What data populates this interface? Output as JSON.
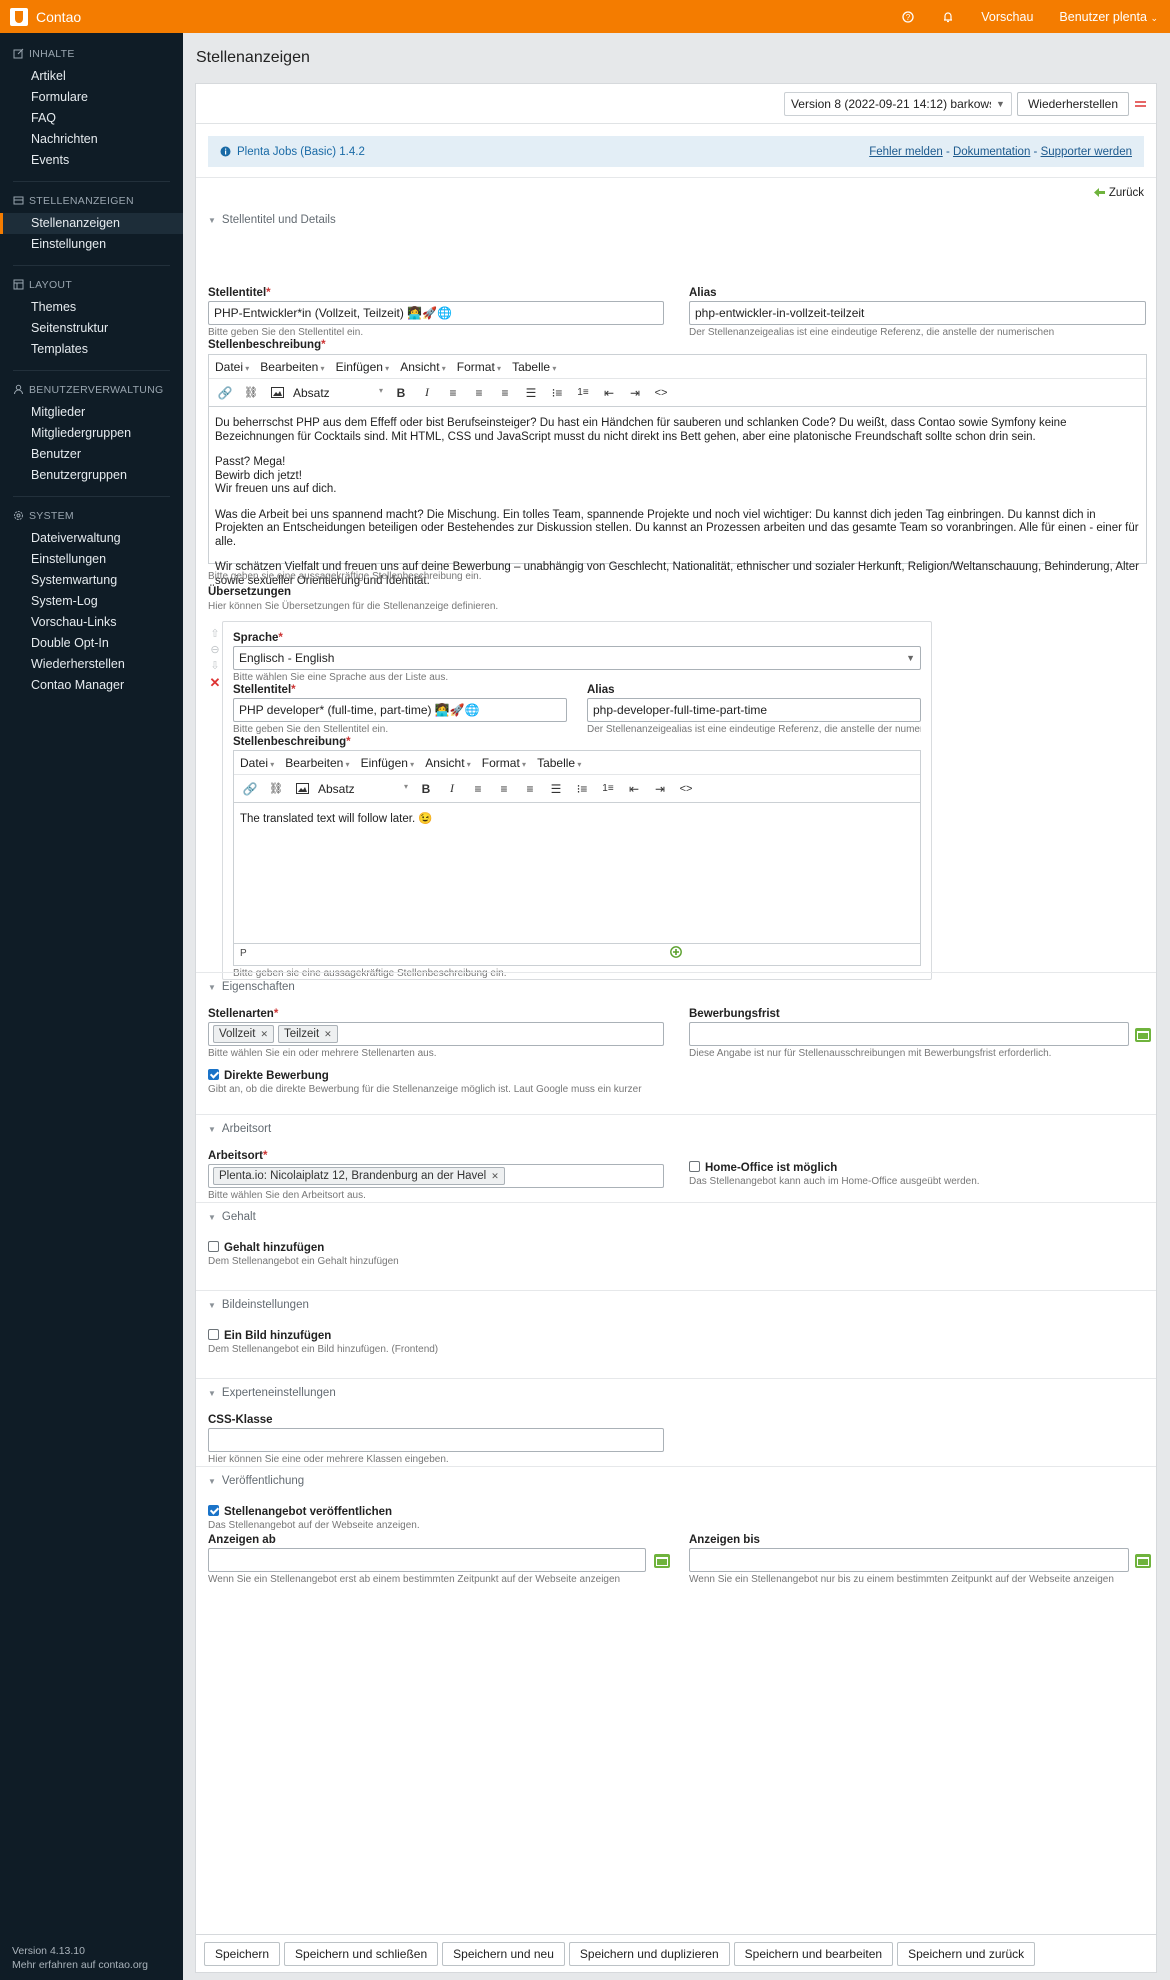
{
  "topbar": {
    "app": "Contao",
    "preview": "Vorschau",
    "user": "Benutzer plenta"
  },
  "sidebar": {
    "groups": [
      {
        "title": "INHALTE",
        "items": [
          "Artikel",
          "Formulare",
          "FAQ",
          "Nachrichten",
          "Events"
        ]
      },
      {
        "title": "STELLENANZEIGEN",
        "items": [
          "Stellenanzeigen",
          "Einstellungen"
        ]
      },
      {
        "title": "LAYOUT",
        "items": [
          "Themes",
          "Seitenstruktur",
          "Templates"
        ]
      },
      {
        "title": "BENUTZERVERWALTUNG",
        "items": [
          "Mitglieder",
          "Mitgliedergruppen",
          "Benutzer",
          "Benutzergruppen"
        ]
      },
      {
        "title": "SYSTEM",
        "items": [
          "Dateiverwaltung",
          "Einstellungen",
          "Systemwartung",
          "System-Log",
          "Vorschau-Links",
          "Double Opt-In",
          "Wiederherstellen",
          "Contao Manager"
        ]
      }
    ],
    "version": "Version 4.13.10",
    "more": "Mehr erfahren auf contao.org"
  },
  "page": {
    "title": "Stellenanzeigen"
  },
  "version_bar": {
    "version": "Version 8 (2022-09-21 14:12) barkowski",
    "restore": "Wiederherstellen"
  },
  "info": {
    "plugin": "Plenta Jobs (Basic) 1.4.2",
    "bug": "Fehler melden",
    "sep1": " - ",
    "docs": "Dokumentation",
    "sep2": " - ",
    "support": "Supporter werden"
  },
  "back": "Zurück",
  "sections": {
    "details": "Stellentitel und Details",
    "props": "Eigenschaften",
    "location": "Arbeitsort",
    "salary": "Gehalt",
    "image": "Bildeinstellungen",
    "expert": "Experteneinstellungen",
    "publish": "Veröffentlichung"
  },
  "details": {
    "title_label": "Stellentitel",
    "title_value": "PHP-Entwickler*in (Vollzeit, Teilzeit) 👩‍💻🚀🌐",
    "title_tip": "Bitte geben Sie den Stellentitel ein.",
    "alias_label": "Alias",
    "alias_value": "php-entwickler-in-vollzeit-teilzeit",
    "alias_tip": "Der Stellenanzeigealias ist eine eindeutige Referenz, die anstelle der numerischen",
    "desc_label": "Stellenbeschreibung",
    "desc_tip": "Bitte geben sie eine aussagekräftige Stellenbeschreibung ein.",
    "desc_p1": "Du beherrschst PHP aus dem Effeff oder bist Berufseinsteiger? Du hast ein Händchen für sauberen und schlanken Code? Du weißt, dass Contao sowie Symfony keine Bezeichnungen für Cocktails sind. Mit HTML, CSS und JavaScript musst du nicht direkt ins Bett gehen, aber eine platonische Freundschaft sollte schon drin sein.",
    "desc_p2a": "Passt? Mega!",
    "desc_p2b": "Bewirb dich jetzt!",
    "desc_p2c": "Wir freuen uns auf dich.",
    "desc_p3": "Was die Arbeit bei uns spannend macht? Die Mischung. Ein tolles Team, spannende Projekte und noch viel wichtiger: Du kannst dich jeden Tag einbringen. Du kannst dich in Projekten an Entscheidungen beteiligen oder Bestehendes zur Diskussion stellen. Du kannst an Prozessen arbeiten und das gesamte Team so voranbringen. Alle für einen - einer für alle.",
    "desc_p4": "Wir schätzen Vielfalt und freuen uns auf deine Bewerbung – unabhängig von Geschlecht, Nationalität, ethnischer und sozialer Herkunft, Religion/Weltanschauung, Behinderung, Alter sowie sexueller Orientierung und Identität."
  },
  "editor": {
    "menus": [
      "Datei",
      "Bearbeiten",
      "Einfügen",
      "Ansicht",
      "Format",
      "Tabelle"
    ],
    "block": "Absatz",
    "path": "P"
  },
  "translations": {
    "label": "Übersetzungen",
    "tip": "Hier können Sie Übersetzungen für die Stellenanzeige definieren.",
    "lang_label": "Sprache",
    "lang_value": "Englisch - English",
    "lang_tip": "Bitte wählen Sie eine Sprache aus der Liste aus.",
    "title_label": "Stellentitel",
    "title_value": "PHP developer* (full-time, part-time) 👩‍💻🚀🌐",
    "title_tip": "Bitte geben Sie den Stellentitel ein.",
    "alias_label": "Alias",
    "alias_value": "php-developer-full-time-part-time",
    "alias_tip": "Der Stellenanzeigealias ist eine eindeutige Referenz, die anstelle der numerischen",
    "desc_label": "Stellenbeschreibung",
    "desc_text": "The translated text will follow later. 😉",
    "desc_tip": "Bitte geben sie eine aussagekräftige Stellenbeschreibung ein."
  },
  "props": {
    "types_label": "Stellenarten",
    "types": [
      "Vollzeit",
      "Teilzeit"
    ],
    "types_tip": "Bitte wählen Sie ein oder mehrere Stellenarten aus.",
    "deadline_label": "Bewerbungsfrist",
    "deadline_tip": "Diese Angabe ist nur für Stellenausschreibungen mit Bewerbungsfrist erforderlich.",
    "direct_label": "Direkte Bewerbung",
    "direct_tip": "Gibt an, ob die direkte Bewerbung für die Stellenanzeige möglich ist. Laut Google muss ein kurzer"
  },
  "location": {
    "label": "Arbeitsort",
    "value": "Plenta.io: Nicolaiplatz 12, Brandenburg an der Havel",
    "tip": "Bitte wählen Sie den Arbeitsort aus.",
    "home_label": "Home-Office ist möglich",
    "home_tip": "Das Stellenangebot kann auch im Home-Office ausgeübt werden."
  },
  "salary": {
    "label": "Gehalt hinzufügen",
    "tip": "Dem Stellenangebot ein Gehalt hinzufügen"
  },
  "image": {
    "label": "Ein Bild hinzufügen",
    "tip": "Dem Stellenangebot ein Bild hinzufügen. (Frontend)"
  },
  "expert": {
    "label": "CSS-Klasse",
    "tip": "Hier können Sie eine oder mehrere Klassen eingeben."
  },
  "publish": {
    "pub_label": "Stellenangebot veröffentlichen",
    "pub_tip": "Das Stellenangebot auf der Webseite anzeigen.",
    "from_label": "Anzeigen ab",
    "from_tip": "Wenn Sie ein Stellenangebot erst ab einem bestimmten Zeitpunkt auf der Webseite anzeigen",
    "to_label": "Anzeigen bis",
    "to_tip": "Wenn Sie ein Stellenangebot nur bis zu einem bestimmten Zeitpunkt auf der Webseite anzeigen"
  },
  "buttons": [
    "Speichern",
    "Speichern und schließen",
    "Speichern und neu",
    "Speichern und duplizieren",
    "Speichern und bearbeiten",
    "Speichern und zurück"
  ]
}
